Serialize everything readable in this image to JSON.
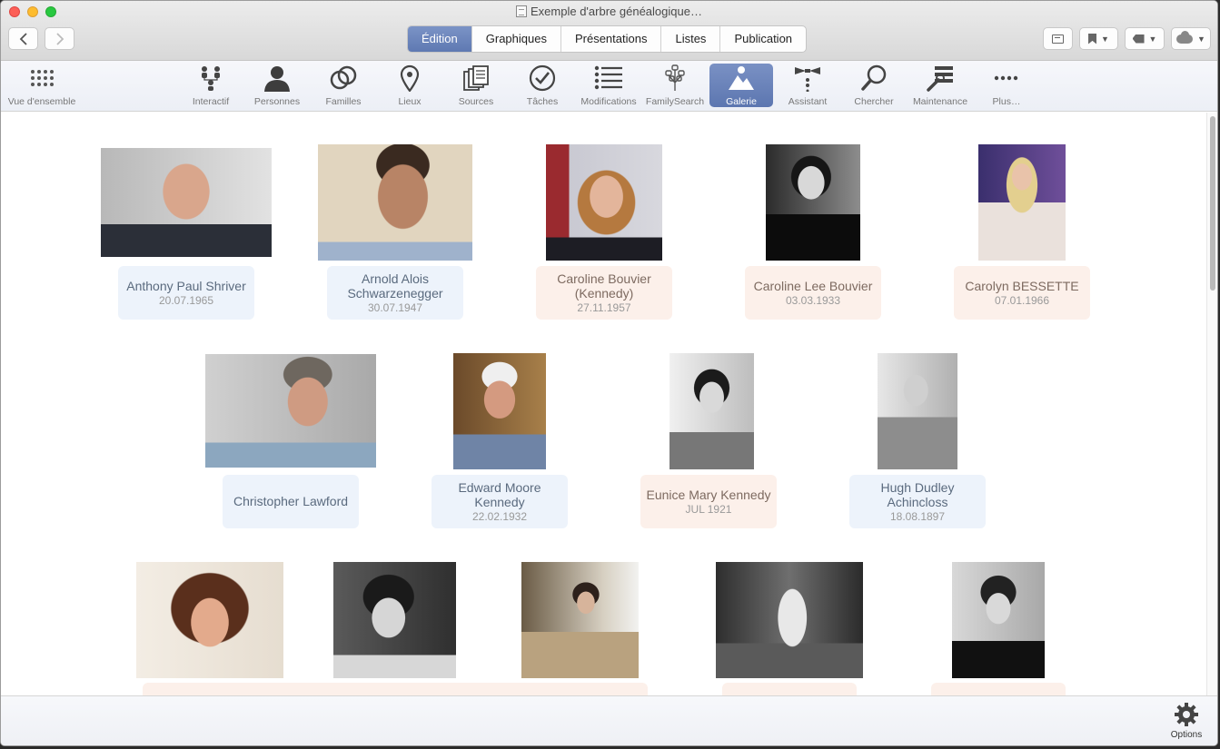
{
  "window": {
    "title": "Exemple d'arbre généalogique…"
  },
  "nav": {
    "back_icon": "chevron-left-icon",
    "forward_icon": "chevron-right-icon"
  },
  "modes": [
    {
      "label": "Édition",
      "active": true
    },
    {
      "label": "Graphiques",
      "active": false
    },
    {
      "label": "Présentations",
      "active": false
    },
    {
      "label": "Listes",
      "active": false
    },
    {
      "label": "Publication",
      "active": false
    }
  ],
  "right_buttons": [
    "sidebar-icon",
    "bookmark-icon",
    "tag-icon",
    "cloud-icon"
  ],
  "toolbar": {
    "overview": "Vue d'ensemble",
    "items": [
      {
        "label": "Interactif",
        "icon": "interactive-tree-icon"
      },
      {
        "label": "Personnes",
        "icon": "person-icon"
      },
      {
        "label": "Familles",
        "icon": "rings-icon"
      },
      {
        "label": "Lieux",
        "icon": "location-pin-icon"
      },
      {
        "label": "Sources",
        "icon": "sources-icon"
      },
      {
        "label": "Tâches",
        "icon": "checkmark-icon"
      },
      {
        "label": "Modifications",
        "icon": "list-icon"
      },
      {
        "label": "FamilySearch",
        "icon": "familysearch-tree-icon"
      },
      {
        "label": "Galerie",
        "icon": "gallery-icon",
        "active": true
      },
      {
        "label": "Assistant",
        "icon": "assistant-bowtie-icon"
      },
      {
        "label": "Chercher",
        "icon": "magnifier-icon"
      },
      {
        "label": "Maintenance",
        "icon": "maintenance-icon"
      },
      {
        "label": "Plus…",
        "icon": "more-dots-icon"
      }
    ]
  },
  "gallery": {
    "row1": [
      {
        "name": "Anthony Paul Shriver",
        "date": "20.07.1965",
        "gender": "male"
      },
      {
        "name": "Arnold Alois Schwarzenegger",
        "date": "30.07.1947",
        "gender": "male"
      },
      {
        "name": "Caroline Bouvier (Kennedy)",
        "date": "27.11.1957",
        "gender": "female"
      },
      {
        "name": "Caroline Lee Bouvier",
        "date": "03.03.1933",
        "gender": "female"
      },
      {
        "name": "Carolyn BESSETTE",
        "date": "07.01.1966",
        "gender": "female"
      }
    ],
    "row2": [
      {
        "name": "Christopher Lawford",
        "date": "",
        "gender": "male"
      },
      {
        "name": "Edward Moore Kennedy",
        "date": "22.02.1932",
        "gender": "male"
      },
      {
        "name": "Eunice Mary Kennedy",
        "date": "JUL 1921",
        "gender": "female"
      },
      {
        "name": "Hugh Dudley Achincloss",
        "date": "18.08.1897",
        "gender": "male"
      }
    ]
  },
  "bottom": {
    "options_label": "Options",
    "options_icon": "gear-icon"
  }
}
